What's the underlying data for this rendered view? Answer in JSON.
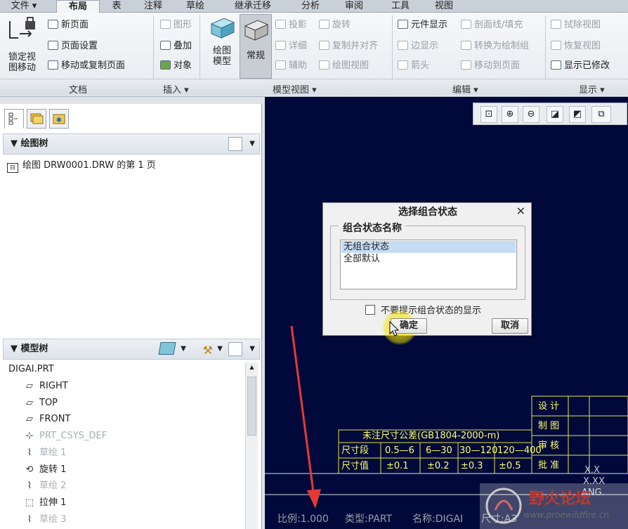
{
  "tabs": [
    "文件 ▾",
    "布局",
    "表",
    "注释",
    "草绘",
    "继承迁移",
    "分析",
    "审阅",
    "工具",
    "视图"
  ],
  "ribbon": {
    "lock_view": "锁定视图移动",
    "new_page": "新页面",
    "page_setup": "页面设置",
    "move_copy_page": "移动或复制页面",
    "graphics": "图形",
    "overlay": "叠加",
    "object": "对象",
    "drawing_model": "绘图模型",
    "general": "常规",
    "projection": "投影",
    "detail": "详细",
    "auxiliary": "辅助",
    "rotate": "旋转",
    "copy_align": "复制并对齐",
    "drawing_view": "绘图视图",
    "component_display": "元件显示",
    "edge_display": "边显示",
    "arrow": "箭头",
    "section_line": "剖面线/填充",
    "convert_draw_group": "转换为绘制组",
    "move_to_page": "移动到页面",
    "erase_view": "拭除视图",
    "restore_view": "恢复视图",
    "show_modified": "显示已修改",
    "groups": {
      "document": "文档",
      "insert": "插入 ▾",
      "model_views": "模型视图 ▾",
      "edit": "编辑 ▾",
      "display": "显示 ▾"
    }
  },
  "drawing_tree": {
    "header": "绘图树",
    "item": "绘图 DRW0001.DRW 的第 1 页"
  },
  "model_tree": {
    "header": "模型树",
    "root": "DIGAI.PRT",
    "items": [
      {
        "label": "RIGHT",
        "icon": "datum-plane-icon",
        "dim": false
      },
      {
        "label": "TOP",
        "icon": "datum-plane-icon",
        "dim": false
      },
      {
        "label": "FRONT",
        "icon": "datum-plane-icon",
        "dim": false
      },
      {
        "label": "PRT_CSYS_DEF",
        "icon": "csys-icon",
        "dim": true
      },
      {
        "label": "草绘 1",
        "icon": "sketch-icon",
        "dim": true
      },
      {
        "label": "旋转 1",
        "icon": "revolve-icon",
        "dim": false
      },
      {
        "label": "草绘 2",
        "icon": "sketch-icon",
        "dim": true
      },
      {
        "label": "拉伸 1",
        "icon": "extrude-icon",
        "dim": false
      },
      {
        "label": "草绘 3",
        "icon": "sketch-icon",
        "dim": true
      }
    ]
  },
  "dialog": {
    "title": "选择组合状态",
    "group_label": "组合状态名称",
    "options": [
      "无组合状态",
      "全部默认"
    ],
    "selected": "无组合状态",
    "checkbox_label": "不要提示组合状态的显示",
    "checkbox_checked": false,
    "ok": "确定",
    "cancel": "取消"
  },
  "title_block": {
    "tolerance_title": "未注尺寸公差(GB1804-2000-m)",
    "row1_label": "尺寸段",
    "row1": [
      "0.5—6",
      "6—30",
      "30—120",
      "120—400"
    ],
    "row2_label": "尺寸值",
    "row2": [
      "±0.1",
      "±0.2",
      "±0.3",
      "±0.5"
    ],
    "sign": [
      "设 计",
      "制 图",
      "审 核",
      "批 准"
    ],
    "xx": [
      "X.X",
      "X.XX",
      "ANG."
    ]
  },
  "status": {
    "scale": "比例:1.000",
    "type": "类型:PART",
    "name": "名称:DIGAI",
    "size": "尺寸:A3"
  },
  "watermark": {
    "name": "野火论坛",
    "url": "www.proewildfire.cn"
  },
  "colors": {
    "canvas": "#00093a",
    "title_block": "#ffff66",
    "annotation_arrow": "#e53935",
    "cursor_highlight": "#f5e400"
  }
}
